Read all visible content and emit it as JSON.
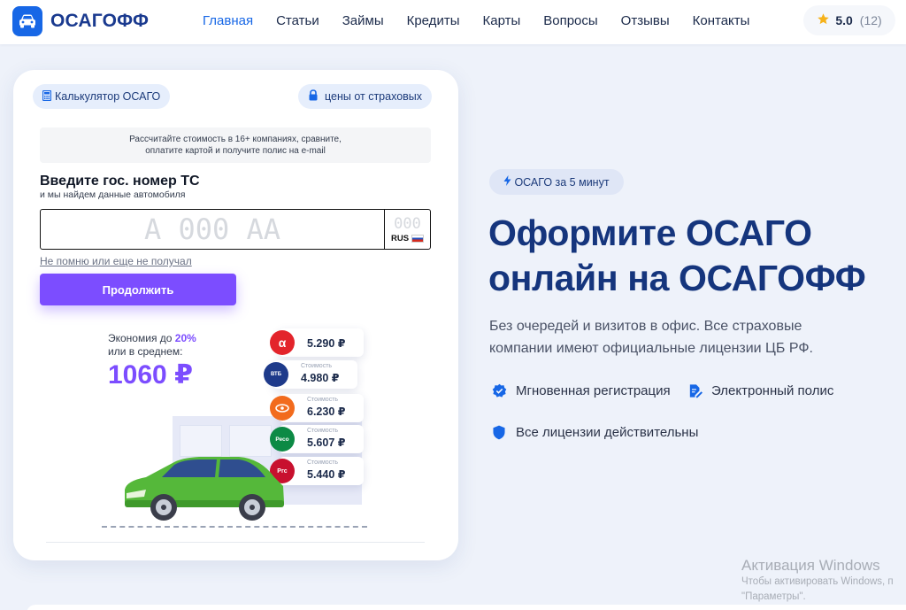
{
  "header": {
    "logo_text": "ОСАГОФФ",
    "nav": [
      {
        "label": "Главная",
        "active": true
      },
      {
        "label": "Статьи",
        "active": false
      },
      {
        "label": "Займы",
        "active": false
      },
      {
        "label": "Кредиты",
        "active": false
      },
      {
        "label": "Карты",
        "active": false
      },
      {
        "label": "Вопросы",
        "active": false
      },
      {
        "label": "Отзывы",
        "active": false
      },
      {
        "label": "Контакты",
        "active": false
      }
    ],
    "rating": {
      "score": "5.0",
      "count": "(12)"
    }
  },
  "calculator": {
    "tag_calc": "Калькулятор ОСАГО",
    "tag_prices": "цены от страховых",
    "info_line1": "Рассчитайте стоимость в 16+ компаниях, сравните,",
    "info_line2": "оплатите картой и получите полис на e-mail",
    "plate_title": "Введите гос. номер ТС",
    "plate_subtitle": "и мы найдем данные автомобиля",
    "plate_placeholder": "А 000 АА",
    "plate_region_placeholder": "000",
    "plate_country": "RUS",
    "forgot_link": "Не помню или еще не получал",
    "continue_button": "Продолжить",
    "economy_text_prefix": "Экономия до ",
    "economy_percent": "20%",
    "economy_text_suffix": "или в среднем:",
    "economy_value": "1060 ₽",
    "quotes": [
      {
        "logo": "α",
        "caption": "",
        "price": "5.290 ₽",
        "color": "#e3242b"
      },
      {
        "logo": "ВТБ",
        "caption": "Стоимость",
        "price": "4.980 ₽",
        "color": "#1e3a8a"
      },
      {
        "logo": "",
        "caption": "Стоимость",
        "price": "6.230 ₽",
        "color": "#f26b1d"
      },
      {
        "logo": "Ресо",
        "caption": "Стоимость",
        "price": "5.607 ₽",
        "color": "#0c8a45"
      },
      {
        "logo": "Pгс",
        "caption": "Стоимость",
        "price": "5.440 ₽",
        "color": "#c8102e"
      }
    ]
  },
  "hero": {
    "tag": "ОСАГО за 5 минут",
    "title_line1": "Оформите ОСАГО",
    "title_line2": "онлайн на ОСАГОФФ",
    "description": "Без очередей и визитов в офис. Все страховые компании имеют официальные лицензии ЦБ РФ.",
    "features": [
      {
        "label": "Мгновенная регистрация",
        "icon": "check-badge-icon"
      },
      {
        "label": "Электронный полис",
        "icon": "document-edit-icon"
      },
      {
        "label": "Все лицензии действительны",
        "icon": "shield-icon"
      }
    ]
  },
  "watermark": {
    "title": "Активация Windows",
    "line1": "Чтобы активировать Windows, п",
    "line2": "\"Параметры\"."
  },
  "colors": {
    "primary": "#1767e6",
    "accent": "#7c4dff",
    "heading": "#15357d"
  }
}
